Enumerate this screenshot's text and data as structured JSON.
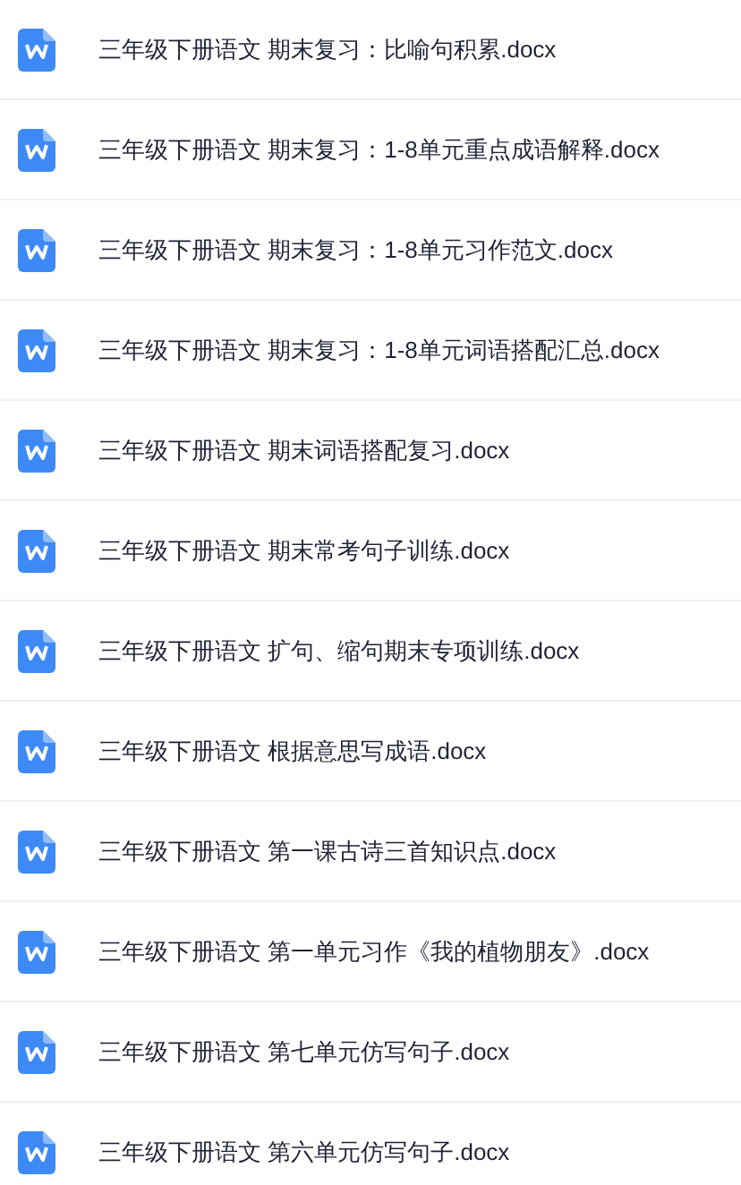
{
  "files": [
    {
      "name": "三年级下册语文 期末复习：比喻句积累.docx"
    },
    {
      "name": "三年级下册语文 期末复习：1-8单元重点成语解释.docx"
    },
    {
      "name": "三年级下册语文 期末复习：1-8单元习作范文.docx"
    },
    {
      "name": "三年级下册语文 期末复习：1-8单元词语搭配汇总.docx"
    },
    {
      "name": "三年级下册语文 期末词语搭配复习.docx"
    },
    {
      "name": "三年级下册语文 期末常考句子训练.docx"
    },
    {
      "name": "三年级下册语文 扩句、缩句期末专项训练.docx"
    },
    {
      "name": "三年级下册语文 根据意思写成语.docx"
    },
    {
      "name": "三年级下册语文 第一课古诗三首知识点.docx"
    },
    {
      "name": "三年级下册语文 第一单元习作《我的植物朋友》.docx"
    },
    {
      "name": "三年级下册语文 第七单元仿写句子.docx"
    },
    {
      "name": "三年级下册语文 第六单元仿写句子.docx"
    }
  ]
}
